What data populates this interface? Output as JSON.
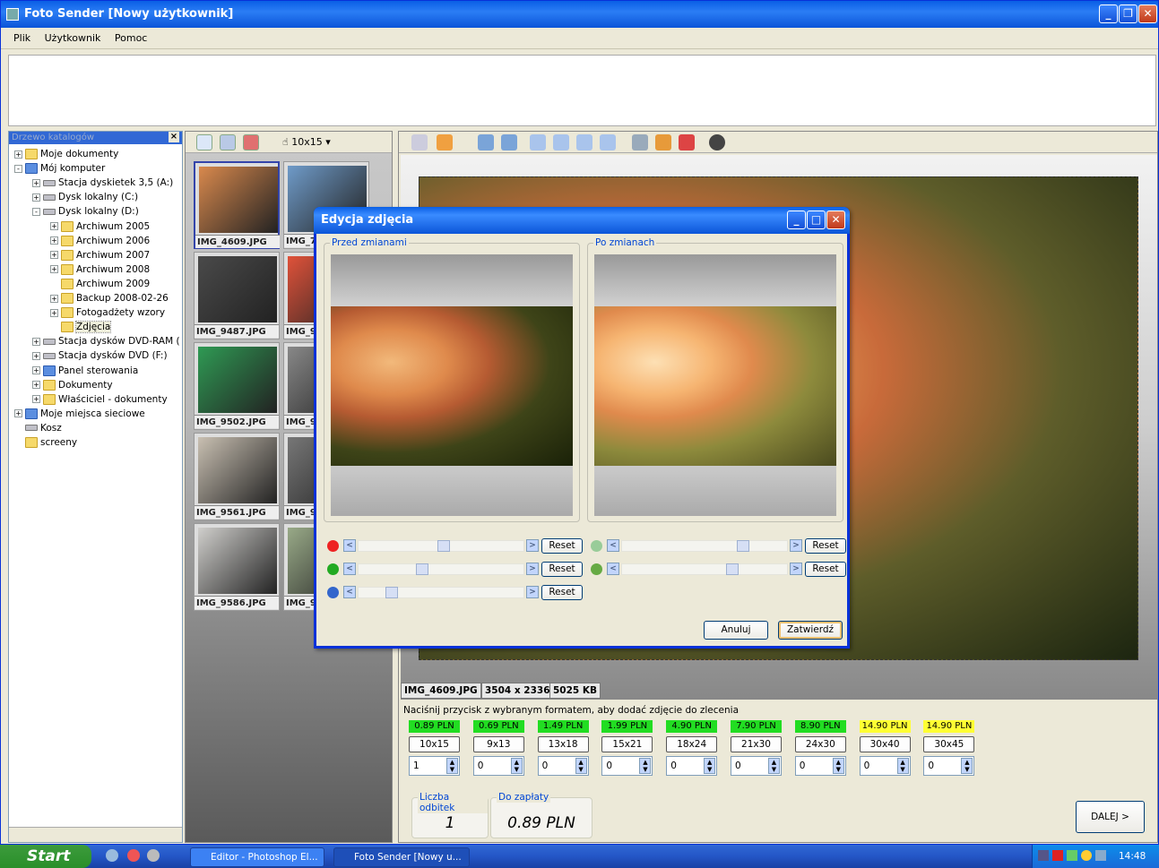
{
  "window": {
    "title": "Foto Sender [Nowy użytkownik]"
  },
  "menu": [
    "Plik",
    "Użytkownik",
    "Pomoc"
  ],
  "tree": {
    "header": "Drzewo katalogów",
    "items": [
      {
        "label": "Moje dokumenty",
        "level": 0,
        "icon": "folder-icon",
        "expand": "+"
      },
      {
        "label": "Mój komputer",
        "level": 0,
        "icon": "computer-icon",
        "expand": "-"
      },
      {
        "label": "Stacja dyskietek 3,5 (A:)",
        "level": 1,
        "icon": "floppy-icon",
        "expand": "+"
      },
      {
        "label": "Dysk lokalny (C:)",
        "level": 1,
        "icon": "drive-icon",
        "expand": "+"
      },
      {
        "label": "Dysk lokalny (D:)",
        "level": 1,
        "icon": "drive-icon",
        "expand": "-"
      },
      {
        "label": "Archiwum 2005",
        "level": 2,
        "icon": "folder-icon",
        "expand": "+"
      },
      {
        "label": "Archiwum 2006",
        "level": 2,
        "icon": "folder-icon",
        "expand": "+"
      },
      {
        "label": "Archiwum 2007",
        "level": 2,
        "icon": "folder-icon",
        "expand": "+"
      },
      {
        "label": "Archiwum 2008",
        "level": 2,
        "icon": "folder-icon",
        "expand": "+"
      },
      {
        "label": "Archiwum 2009",
        "level": 2,
        "icon": "folder-icon",
        "expand": ""
      },
      {
        "label": "Backup 2008-02-26",
        "level": 2,
        "icon": "folder-icon",
        "expand": "+"
      },
      {
        "label": "Fotogadżety wzory",
        "level": 2,
        "icon": "folder-icon",
        "expand": "+"
      },
      {
        "label": "Zdjęcia",
        "level": 2,
        "icon": "folder-icon",
        "expand": "",
        "selected": true
      },
      {
        "label": "Stacja dysków DVD-RAM (",
        "level": 1,
        "icon": "dvd-icon",
        "expand": "+"
      },
      {
        "label": "Stacja dysków DVD (F:)",
        "level": 1,
        "icon": "dvd-icon",
        "expand": "+"
      },
      {
        "label": "Panel sterowania",
        "level": 1,
        "icon": "control-panel-icon",
        "expand": "+"
      },
      {
        "label": "Dokumenty",
        "level": 1,
        "icon": "folder-icon",
        "expand": "+"
      },
      {
        "label": "Właściciel - dokumenty",
        "level": 1,
        "icon": "folder-icon",
        "expand": "+"
      },
      {
        "label": "Moje miejsca sieciowe",
        "level": 0,
        "icon": "network-icon",
        "expand": "+"
      },
      {
        "label": "Kosz",
        "level": 0,
        "icon": "recycle-bin-icon",
        "expand": ""
      },
      {
        "label": "screeny",
        "level": 0,
        "icon": "folder-icon",
        "expand": ""
      }
    ]
  },
  "thumbs": {
    "format": "10x15",
    "items": [
      {
        "name": "IMG_4609.JPG",
        "color": "#d9894d"
      },
      {
        "name": "IMG_7",
        "color": "#6f9bc9"
      },
      {
        "name": "IMG_9487.JPG",
        "color": "#4a4a4a"
      },
      {
        "name": "IMG_9",
        "color": "#e0523a"
      },
      {
        "name": "IMG_9502.JPG",
        "color": "#2f9a54"
      },
      {
        "name": "IMG_9",
        "color": "#888"
      },
      {
        "name": "IMG_9561.JPG",
        "color": "#c9c0b2"
      },
      {
        "name": "IMG_9",
        "color": "#777"
      },
      {
        "name": "IMG_9586.JPG",
        "color": "#d0cfcc"
      },
      {
        "name": "IMG_9",
        "color": "#9a8"
      }
    ]
  },
  "info": {
    "filename": "IMG_4609.JPG",
    "dimensions": "3504 x 2336",
    "size": "5025 KB"
  },
  "order": {
    "hint": "Naciśnij przycisk z wybranym formatem, aby dodać zdjęcie do zlecenia",
    "formats": [
      {
        "price": "0.89 PLN",
        "label": "10x15",
        "qty": "1",
        "color": "#22dd22"
      },
      {
        "price": "0.69 PLN",
        "label": "9x13",
        "qty": "0",
        "color": "#22dd22"
      },
      {
        "price": "1.49 PLN",
        "label": "13x18",
        "qty": "0",
        "color": "#22dd22"
      },
      {
        "price": "1.99 PLN",
        "label": "15x21",
        "qty": "0",
        "color": "#22dd22"
      },
      {
        "price": "4.90 PLN",
        "label": "18x24",
        "qty": "0",
        "color": "#22dd22"
      },
      {
        "price": "7.90 PLN",
        "label": "21x30",
        "qty": "0",
        "color": "#22dd22"
      },
      {
        "price": "8.90 PLN",
        "label": "24x30",
        "qty": "0",
        "color": "#22dd22"
      },
      {
        "price": "14.90 PLN",
        "label": "30x40",
        "qty": "0",
        "color": "#ffff33"
      },
      {
        "price": "14.90 PLN",
        "label": "30x45",
        "qty": "0",
        "color": "#ffff33"
      }
    ]
  },
  "summary": {
    "count_label": "Liczba odbitek",
    "count": "1",
    "pay_label": "Do zapłaty",
    "pay": "0.89 PLN",
    "next": "DALEJ >"
  },
  "dialog": {
    "title": "Edycja zdjęcia",
    "before": "Przed zmianami",
    "after": "Po zmianach",
    "reset": "Reset",
    "cancel": "Anuluj",
    "confirm": "Zatwierdź",
    "sliders": [
      {
        "name": "red-slider",
        "value": 0.52
      },
      {
        "name": "green-slider",
        "value": 0.38
      },
      {
        "name": "blue-slider",
        "value": 0.18
      },
      {
        "name": "contrast-slider",
        "value": 0.75
      },
      {
        "name": "brightness-slider",
        "value": 0.68
      }
    ]
  },
  "taskbar": {
    "start": "Start",
    "tasks": [
      "Editor - Photoshop El...",
      "Foto Sender [Nowy u..."
    ],
    "clock": "14:48"
  }
}
